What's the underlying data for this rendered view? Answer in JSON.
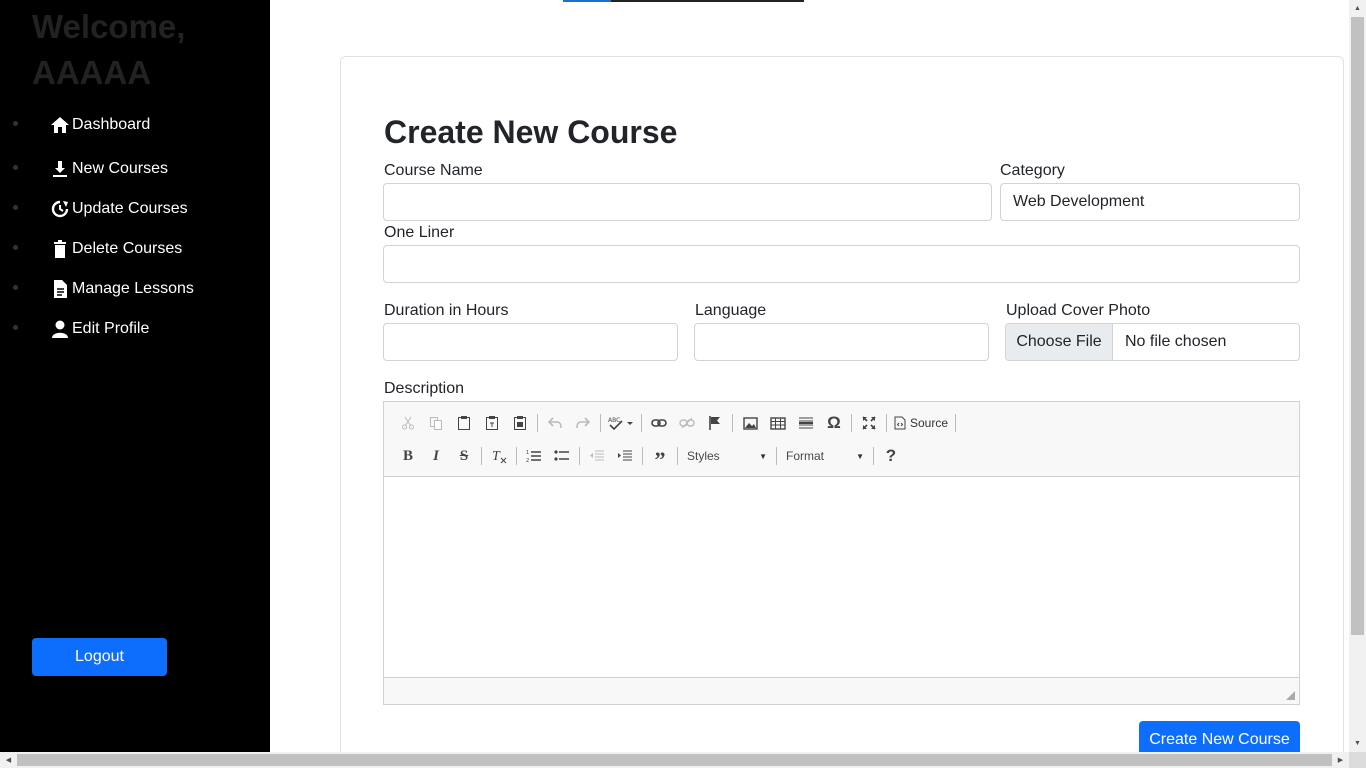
{
  "sidebar": {
    "welcome": "Welcome, AAAAA",
    "items": [
      {
        "label": "Dashboard",
        "icon": "home-icon"
      },
      {
        "label": "New Courses",
        "icon": "download-icon"
      },
      {
        "label": "Update Courses",
        "icon": "refresh-icon"
      },
      {
        "label": "Delete Courses",
        "icon": "trash-icon"
      },
      {
        "label": "Manage Lessons",
        "icon": "document-icon"
      },
      {
        "label": "Edit Profile",
        "icon": "user-icon"
      }
    ],
    "logout_label": "Logout"
  },
  "form": {
    "title": "Create New Course",
    "course_name": {
      "label": "Course Name",
      "value": ""
    },
    "category": {
      "label": "Category",
      "value": "Web Development"
    },
    "one_liner": {
      "label": "One Liner",
      "value": ""
    },
    "duration": {
      "label": "Duration in Hours",
      "value": ""
    },
    "language": {
      "label": "Language",
      "value": ""
    },
    "cover_photo": {
      "label": "Upload Cover Photo",
      "button": "Choose File",
      "status": "No file chosen"
    },
    "description": {
      "label": "Description",
      "source_label": "Source",
      "styles_label": "Styles",
      "format_label": "Format"
    },
    "submit_label": "Create New Course"
  },
  "colors": {
    "primary": "#0d6efd",
    "sidebar_bg": "#000000"
  }
}
